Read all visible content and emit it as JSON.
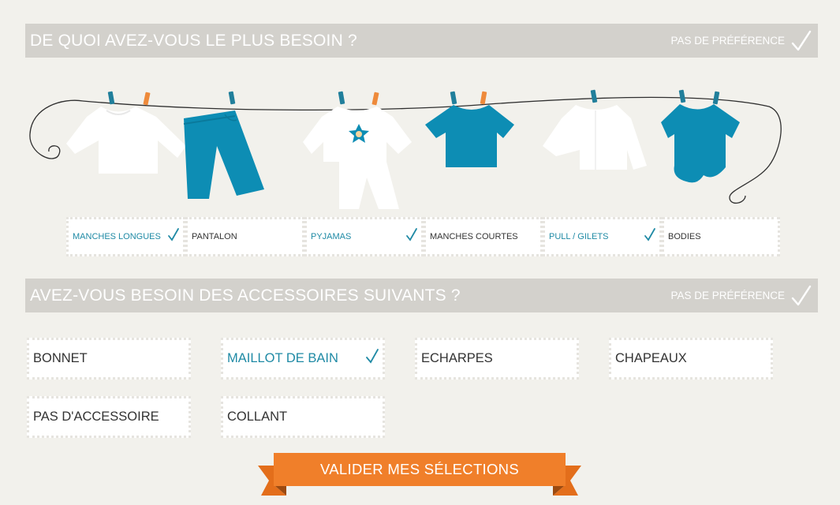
{
  "section_needs": {
    "title": "DE QUOI AVEZ-VOUS LE PLUS BESOIN ?",
    "no_preference_label": "PAS DE PRÉFÉRENCE",
    "categories": [
      {
        "label": "MANCHES LONGUES",
        "selected": true
      },
      {
        "label": "PANTALON",
        "selected": false
      },
      {
        "label": "PYJAMAS",
        "selected": true
      },
      {
        "label": "MANCHES COURTES",
        "selected": false
      },
      {
        "label": "PULL / GILETS",
        "selected": true
      },
      {
        "label": "BODIES",
        "selected": false
      }
    ]
  },
  "section_accessories": {
    "title": "AVEZ-VOUS BESOIN DES ACCESSOIRES SUIVANTS ?",
    "no_preference_label": "PAS DE PRÉFÉRENCE",
    "items": [
      {
        "label": "BONNET",
        "selected": false
      },
      {
        "label": "MAILLOT DE BAIN",
        "selected": true
      },
      {
        "label": "ECHARPES",
        "selected": false
      },
      {
        "label": "CHAPEAUX",
        "selected": false
      },
      {
        "label": "PAS D'ACCESSOIRE",
        "selected": false
      },
      {
        "label": "COLLANT",
        "selected": false
      }
    ]
  },
  "validate_button": {
    "label": "VALIDER MES SÉLECTIONS"
  },
  "colors": {
    "accent_blue": "#1f8aa5",
    "clothing_blue": "#0d8db4",
    "pin_orange": "#ee8a3b",
    "pin_teal": "#217f9b",
    "bar_gray": "#d3d1cc",
    "ribbon_orange": "#f07f2a",
    "background": "#f2f1ec"
  },
  "icons": {
    "check": "check-icon",
    "clothes": [
      "long-sleeve-shirt-icon",
      "pants-icon",
      "pyjamas-icon",
      "tshirt-icon",
      "cardigan-icon",
      "bodysuit-icon"
    ]
  }
}
